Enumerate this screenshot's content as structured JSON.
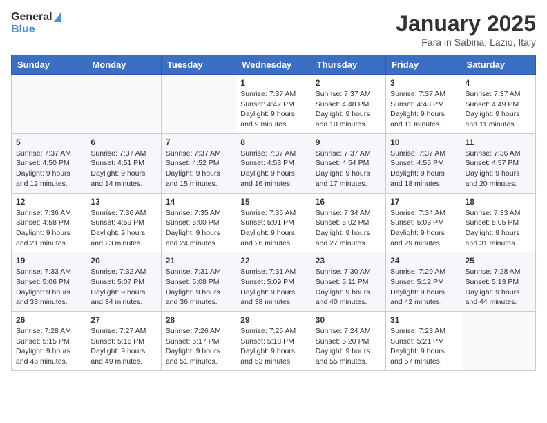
{
  "header": {
    "logo_general": "General",
    "logo_blue": "Blue",
    "title": "January 2025",
    "subtitle": "Fara in Sabina, Lazio, Italy"
  },
  "weekdays": [
    "Sunday",
    "Monday",
    "Tuesday",
    "Wednesday",
    "Thursday",
    "Friday",
    "Saturday"
  ],
  "weeks": [
    [
      {
        "day": "",
        "sunrise": "",
        "sunset": "",
        "daylight": ""
      },
      {
        "day": "",
        "sunrise": "",
        "sunset": "",
        "daylight": ""
      },
      {
        "day": "",
        "sunrise": "",
        "sunset": "",
        "daylight": ""
      },
      {
        "day": "1",
        "sunrise": "Sunrise: 7:37 AM",
        "sunset": "Sunset: 4:47 PM",
        "daylight": "Daylight: 9 hours and 9 minutes."
      },
      {
        "day": "2",
        "sunrise": "Sunrise: 7:37 AM",
        "sunset": "Sunset: 4:48 PM",
        "daylight": "Daylight: 9 hours and 10 minutes."
      },
      {
        "day": "3",
        "sunrise": "Sunrise: 7:37 AM",
        "sunset": "Sunset: 4:48 PM",
        "daylight": "Daylight: 9 hours and 11 minutes."
      },
      {
        "day": "4",
        "sunrise": "Sunrise: 7:37 AM",
        "sunset": "Sunset: 4:49 PM",
        "daylight": "Daylight: 9 hours and 11 minutes."
      }
    ],
    [
      {
        "day": "5",
        "sunrise": "Sunrise: 7:37 AM",
        "sunset": "Sunset: 4:50 PM",
        "daylight": "Daylight: 9 hours and 12 minutes."
      },
      {
        "day": "6",
        "sunrise": "Sunrise: 7:37 AM",
        "sunset": "Sunset: 4:51 PM",
        "daylight": "Daylight: 9 hours and 14 minutes."
      },
      {
        "day": "7",
        "sunrise": "Sunrise: 7:37 AM",
        "sunset": "Sunset: 4:52 PM",
        "daylight": "Daylight: 9 hours and 15 minutes."
      },
      {
        "day": "8",
        "sunrise": "Sunrise: 7:37 AM",
        "sunset": "Sunset: 4:53 PM",
        "daylight": "Daylight: 9 hours and 16 minutes."
      },
      {
        "day": "9",
        "sunrise": "Sunrise: 7:37 AM",
        "sunset": "Sunset: 4:54 PM",
        "daylight": "Daylight: 9 hours and 17 minutes."
      },
      {
        "day": "10",
        "sunrise": "Sunrise: 7:37 AM",
        "sunset": "Sunset: 4:55 PM",
        "daylight": "Daylight: 9 hours and 18 minutes."
      },
      {
        "day": "11",
        "sunrise": "Sunrise: 7:36 AM",
        "sunset": "Sunset: 4:57 PM",
        "daylight": "Daylight: 9 hours and 20 minutes."
      }
    ],
    [
      {
        "day": "12",
        "sunrise": "Sunrise: 7:36 AM",
        "sunset": "Sunset: 4:58 PM",
        "daylight": "Daylight: 9 hours and 21 minutes."
      },
      {
        "day": "13",
        "sunrise": "Sunrise: 7:36 AM",
        "sunset": "Sunset: 4:59 PM",
        "daylight": "Daylight: 9 hours and 23 minutes."
      },
      {
        "day": "14",
        "sunrise": "Sunrise: 7:35 AM",
        "sunset": "Sunset: 5:00 PM",
        "daylight": "Daylight: 9 hours and 24 minutes."
      },
      {
        "day": "15",
        "sunrise": "Sunrise: 7:35 AM",
        "sunset": "Sunset: 5:01 PM",
        "daylight": "Daylight: 9 hours and 26 minutes."
      },
      {
        "day": "16",
        "sunrise": "Sunrise: 7:34 AM",
        "sunset": "Sunset: 5:02 PM",
        "daylight": "Daylight: 9 hours and 27 minutes."
      },
      {
        "day": "17",
        "sunrise": "Sunrise: 7:34 AM",
        "sunset": "Sunset: 5:03 PM",
        "daylight": "Daylight: 9 hours and 29 minutes."
      },
      {
        "day": "18",
        "sunrise": "Sunrise: 7:33 AM",
        "sunset": "Sunset: 5:05 PM",
        "daylight": "Daylight: 9 hours and 31 minutes."
      }
    ],
    [
      {
        "day": "19",
        "sunrise": "Sunrise: 7:33 AM",
        "sunset": "Sunset: 5:06 PM",
        "daylight": "Daylight: 9 hours and 33 minutes."
      },
      {
        "day": "20",
        "sunrise": "Sunrise: 7:32 AM",
        "sunset": "Sunset: 5:07 PM",
        "daylight": "Daylight: 9 hours and 34 minutes."
      },
      {
        "day": "21",
        "sunrise": "Sunrise: 7:31 AM",
        "sunset": "Sunset: 5:08 PM",
        "daylight": "Daylight: 9 hours and 36 minutes."
      },
      {
        "day": "22",
        "sunrise": "Sunrise: 7:31 AM",
        "sunset": "Sunset: 5:09 PM",
        "daylight": "Daylight: 9 hours and 38 minutes."
      },
      {
        "day": "23",
        "sunrise": "Sunrise: 7:30 AM",
        "sunset": "Sunset: 5:11 PM",
        "daylight": "Daylight: 9 hours and 40 minutes."
      },
      {
        "day": "24",
        "sunrise": "Sunrise: 7:29 AM",
        "sunset": "Sunset: 5:12 PM",
        "daylight": "Daylight: 9 hours and 42 minutes."
      },
      {
        "day": "25",
        "sunrise": "Sunrise: 7:28 AM",
        "sunset": "Sunset: 5:13 PM",
        "daylight": "Daylight: 9 hours and 44 minutes."
      }
    ],
    [
      {
        "day": "26",
        "sunrise": "Sunrise: 7:28 AM",
        "sunset": "Sunset: 5:15 PM",
        "daylight": "Daylight: 9 hours and 46 minutes."
      },
      {
        "day": "27",
        "sunrise": "Sunrise: 7:27 AM",
        "sunset": "Sunset: 5:16 PM",
        "daylight": "Daylight: 9 hours and 49 minutes."
      },
      {
        "day": "28",
        "sunrise": "Sunrise: 7:26 AM",
        "sunset": "Sunset: 5:17 PM",
        "daylight": "Daylight: 9 hours and 51 minutes."
      },
      {
        "day": "29",
        "sunrise": "Sunrise: 7:25 AM",
        "sunset": "Sunset: 5:18 PM",
        "daylight": "Daylight: 9 hours and 53 minutes."
      },
      {
        "day": "30",
        "sunrise": "Sunrise: 7:24 AM",
        "sunset": "Sunset: 5:20 PM",
        "daylight": "Daylight: 9 hours and 55 minutes."
      },
      {
        "day": "31",
        "sunrise": "Sunrise: 7:23 AM",
        "sunset": "Sunset: 5:21 PM",
        "daylight": "Daylight: 9 hours and 57 minutes."
      },
      {
        "day": "",
        "sunrise": "",
        "sunset": "",
        "daylight": ""
      }
    ]
  ]
}
